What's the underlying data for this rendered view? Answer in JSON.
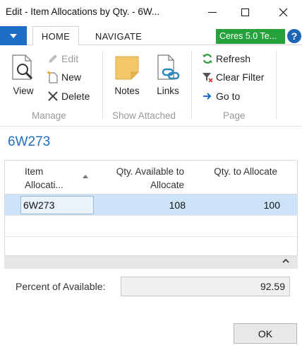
{
  "window": {
    "title": "Edit - Item Allocations by Qty. - 6W...",
    "controls": [
      "minimize",
      "maximize",
      "close"
    ]
  },
  "ribbon": {
    "tabs": [
      {
        "label": "HOME",
        "selected": true
      },
      {
        "label": "NAVIGATE",
        "selected": false
      }
    ],
    "company_badge": "Ceres 5.0 Te...",
    "help_label": "?",
    "groups": {
      "manage": {
        "label": "Manage",
        "view": "View",
        "edit": "Edit",
        "new": "New",
        "delete": "Delete"
      },
      "show_attached": {
        "label": "Show Attached",
        "notes": "Notes",
        "links": "Links"
      },
      "page": {
        "label": "Page",
        "refresh": "Refresh",
        "clear_filter": "Clear Filter",
        "go_to": "Go to"
      }
    }
  },
  "page_title": "6W273",
  "grid": {
    "columns": [
      "Item Allocati...",
      "Qty. Available to Allocate",
      "Qty. to Allocate"
    ],
    "column_header_lines": {
      "c1_line1": "Item",
      "c1_line2": "Allocati...",
      "c2_line1": "Qty. Available to",
      "c2_line2": "Allocate",
      "c3_line1": "Qty. to Allocate"
    },
    "rows": [
      {
        "item_allocation": "6W273",
        "qty_available": "108",
        "qty_to_allocate": "100"
      }
    ]
  },
  "percent_field": {
    "label": "Percent of Available:",
    "value": "92.59"
  },
  "ok_label": "OK",
  "colors": {
    "accent_blue": "#1d6fc6",
    "company_green": "#25a23b",
    "selected_row": "#cde3f7"
  }
}
